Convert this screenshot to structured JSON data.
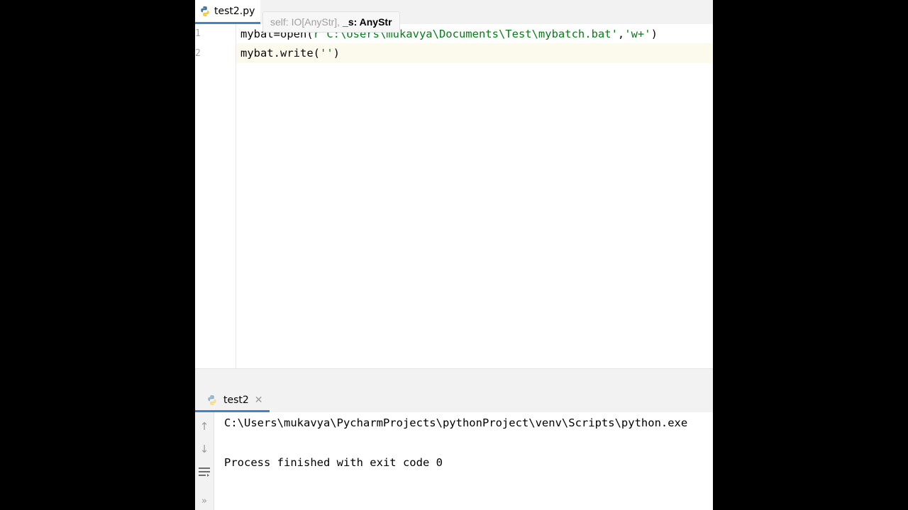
{
  "editor": {
    "tab_label": "test2.py",
    "hint": {
      "params": "self: IO[AnyStr],",
      "current_param": "_s: AnyStr"
    },
    "lines": [
      {
        "number": "1",
        "code": "mybat=open(r'C:\\Users\\mukavya\\Documents\\Test\\mybatch.bat','w+')",
        "code_head": "mybat=open(",
        "code_string": "r'C:\\Users\\mukavya\\Documents\\Test\\mybatch.bat'",
        "code_comma": ",",
        "code_mode": "'w+'",
        "code_tail": ")"
      },
      {
        "number": "2",
        "code_head": "mybat.write(",
        "code_string": "''",
        "code_tail": ")"
      }
    ]
  },
  "run": {
    "tab_label": "test2",
    "console": {
      "command": "C:\\Users\\mukavya\\PycharmProjects\\pythonProject\\venv\\Scripts\\python.exe",
      "result": "Process finished with exit code 0"
    },
    "toolbar": [
      "arrow-up-icon",
      "arrow-down-icon",
      "soft-wrap-icon",
      "more-icon"
    ]
  },
  "colors": {
    "accent": "#4083c9",
    "string": "#067d17",
    "current_line": "#fcfaed"
  }
}
